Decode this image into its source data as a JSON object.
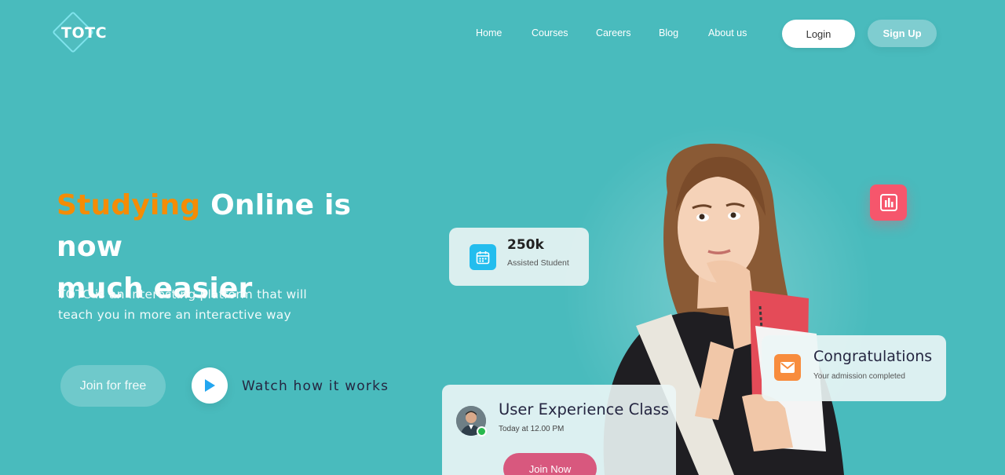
{
  "brand": {
    "logo_text": "TOTC"
  },
  "nav": {
    "items": [
      "Home",
      "Courses",
      "Careers",
      "Blog",
      "About us"
    ],
    "login_label": "Login",
    "signup_label": "Sign Up"
  },
  "hero": {
    "headline_accent": "Studying",
    "headline_rest_line1": " Online is now",
    "headline_line2": "much easier",
    "subtext": "TOTC is an interesting platform that will teach you in more an interactive way",
    "join_label": "Join for free",
    "watch_label": "Watch how it works"
  },
  "cards": {
    "students": {
      "value": "250k",
      "label": "Assisted Student",
      "icon": "calendar-icon"
    },
    "congrats": {
      "title": "Congratulations",
      "subtitle": "Your admission completed",
      "icon": "mail-icon"
    },
    "class": {
      "title": "User Experience Class",
      "time": "Today at 12.00 PM",
      "button": "Join Now"
    }
  },
  "colors": {
    "background": "#49BBBD",
    "accent_orange": "#F48C06",
    "chart_badge": "#F6566C",
    "join_now": "#D8587E"
  }
}
